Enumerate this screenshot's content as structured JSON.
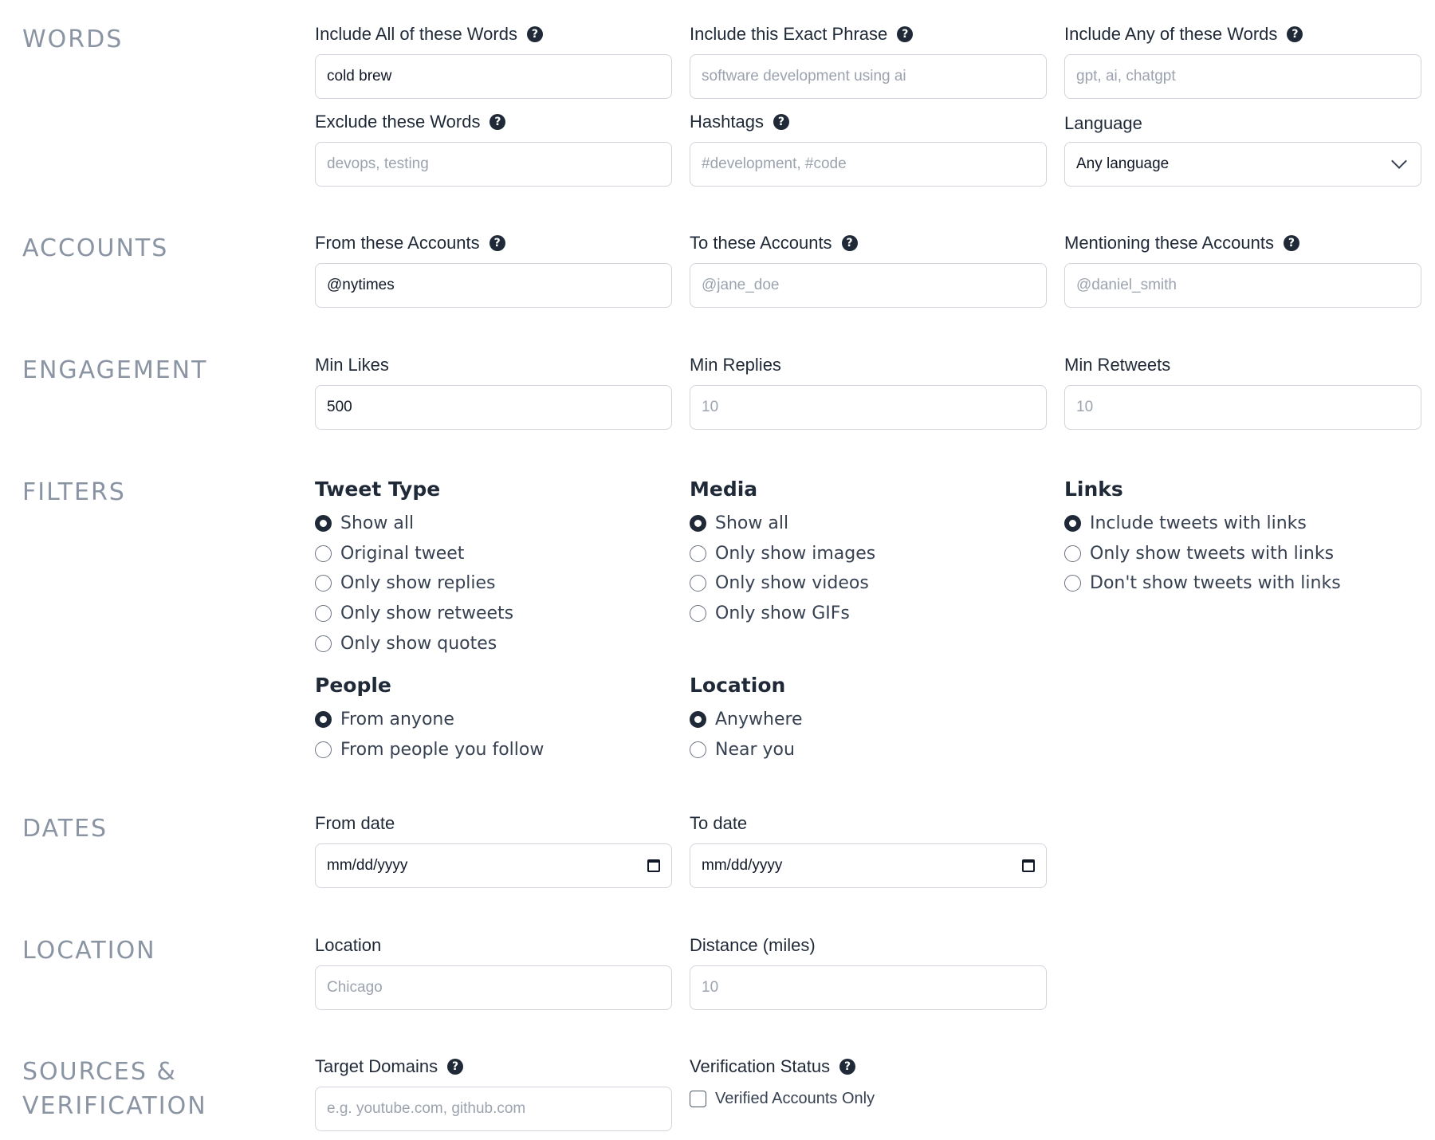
{
  "sections": {
    "words": "WORDS",
    "accounts": "ACCOUNTS",
    "engagement": "ENGAGEMENT",
    "filters": "FILTERS",
    "dates": "DATES",
    "location": "LOCATION",
    "sources_line1": "SOURCES &",
    "sources_line2": "VERIFICATION"
  },
  "words": {
    "all": {
      "label": "Include All of these Words",
      "value": "cold brew"
    },
    "phrase": {
      "label": "Include this Exact Phrase",
      "placeholder": "software development using ai"
    },
    "any": {
      "label": "Include Any of these Words",
      "placeholder": "gpt, ai, chatgpt"
    },
    "exclude": {
      "label": "Exclude these Words",
      "placeholder": "devops, testing"
    },
    "hashtags": {
      "label": "Hashtags",
      "placeholder": "#development, #code"
    },
    "language": {
      "label": "Language",
      "value": "Any language"
    }
  },
  "accounts": {
    "from": {
      "label": "From these Accounts",
      "value": "@nytimes"
    },
    "to": {
      "label": "To these Accounts",
      "placeholder": "@jane_doe"
    },
    "mentioning": {
      "label": "Mentioning these Accounts",
      "placeholder": "@daniel_smith"
    }
  },
  "engagement": {
    "likes": {
      "label": "Min Likes",
      "value": "500"
    },
    "replies": {
      "label": "Min Replies",
      "placeholder": "10"
    },
    "retweets": {
      "label": "Min Retweets",
      "placeholder": "10"
    }
  },
  "filters": {
    "tweet_type": {
      "title": "Tweet Type",
      "options": [
        "Show all",
        "Original tweet",
        "Only show replies",
        "Only show retweets",
        "Only show quotes"
      ],
      "selected": 0
    },
    "media": {
      "title": "Media",
      "options": [
        "Show all",
        "Only show images",
        "Only show videos",
        "Only show GIFs"
      ],
      "selected": 0
    },
    "links": {
      "title": "Links",
      "options": [
        "Include tweets with links",
        "Only show tweets with links",
        "Don't show tweets with links"
      ],
      "selected": 0
    },
    "people": {
      "title": "People",
      "options": [
        "From anyone",
        "From people you follow"
      ],
      "selected": 0
    },
    "location": {
      "title": "Location",
      "options": [
        "Anywhere",
        "Near you"
      ],
      "selected": 0
    }
  },
  "dates": {
    "from": {
      "label": "From date",
      "value": "mm/dd/yyyy"
    },
    "to": {
      "label": "To date",
      "value": "mm/dd/yyyy"
    }
  },
  "location": {
    "location": {
      "label": "Location",
      "placeholder": "Chicago"
    },
    "distance": {
      "label": "Distance (miles)",
      "placeholder": "10"
    }
  },
  "sources": {
    "domains": {
      "label": "Target Domains",
      "placeholder": "e.g. youtube.com, github.com"
    },
    "verification": {
      "label": "Verification Status",
      "checkbox": "Verified Accounts Only"
    }
  },
  "icons": {
    "help": "question-circle-icon",
    "select": "chevron-down-icon",
    "date": "calendar-icon"
  }
}
